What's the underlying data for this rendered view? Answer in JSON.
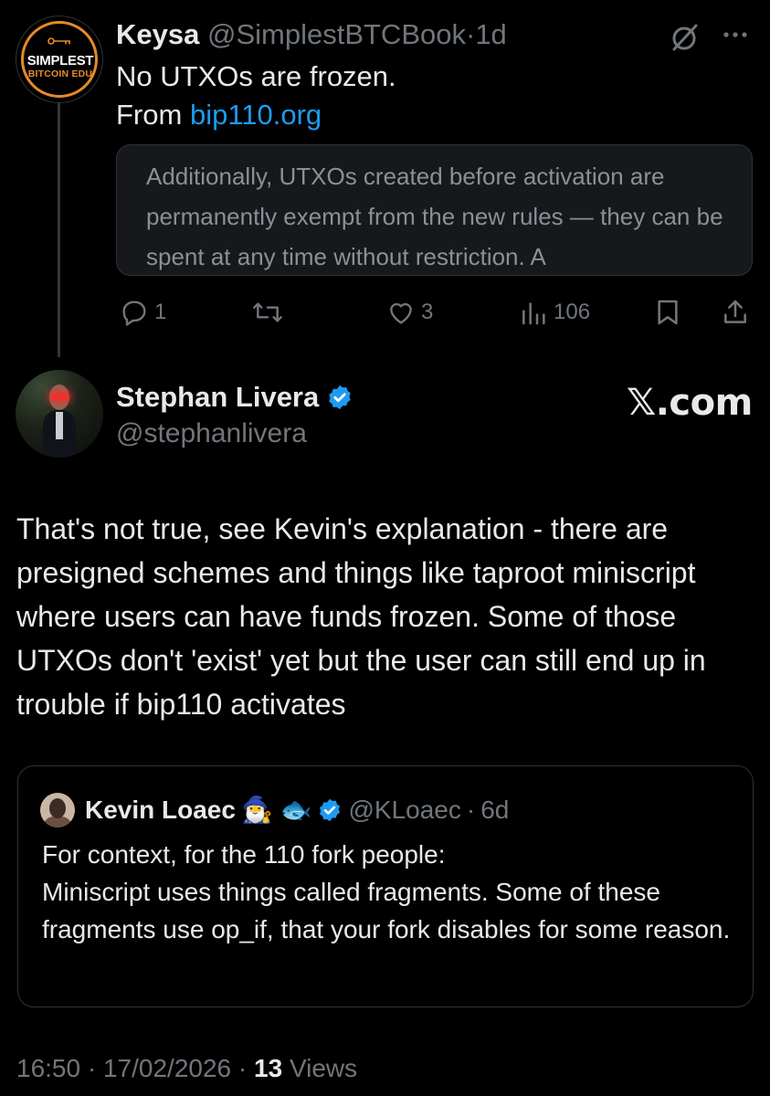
{
  "tweet1": {
    "avatar_line1": "SIMPLEST",
    "avatar_line2": "BITCOIN EDU",
    "name": "Keysa",
    "handle": "@SimplestBTCBook",
    "separator": "·",
    "time": "1d",
    "text_line1": "No UTXOs are frozen.",
    "text_from": "From",
    "link": "bip110.org",
    "quote_text": "Additionally, UTXOs created before activation are permanently exempt from the new rules — they can be spent at any time without restriction. A",
    "replies": "1",
    "likes": "3",
    "views": "106",
    "icons": [
      "grok-icon",
      "more-icon",
      "reply-icon",
      "retweet-icon",
      "like-icon",
      "views-icon",
      "bookmark-icon",
      "share-icon"
    ]
  },
  "tweet2": {
    "name": "Stephan Livera",
    "handle": "@stephanlivera",
    "watermark": "𝕏.com",
    "text": "That's not true, see Kevin's explanation - there are presigned schemes and things like taproot miniscript where users can have funds frozen. Some of those UTXOs don't 'exist' yet but the user can still end up in trouble if bip110 activates",
    "quote": {
      "name": "Kevin Loaec",
      "emojis": "🧙‍♂️ 🐟",
      "handle": "@KLoaec",
      "separator": "·",
      "time": "6d",
      "text_line1": "For context, for the 110 fork people:",
      "text_rest": "Miniscript uses things called fragments. Some of these fragments use op_if, that your fork disables for some reason."
    },
    "footer": {
      "time": "16:50",
      "sep1": "·",
      "date": "17/02/2026",
      "sep2": "·",
      "views_count": "13",
      "views_label": "Views"
    }
  },
  "colors": {
    "background": "#000000",
    "text": "#e7e9ea",
    "muted": "#71767b",
    "link": "#1d9bf0",
    "verified": "#1d9bf0",
    "brand_orange": "#e58a2b",
    "border": "#2f3336"
  }
}
